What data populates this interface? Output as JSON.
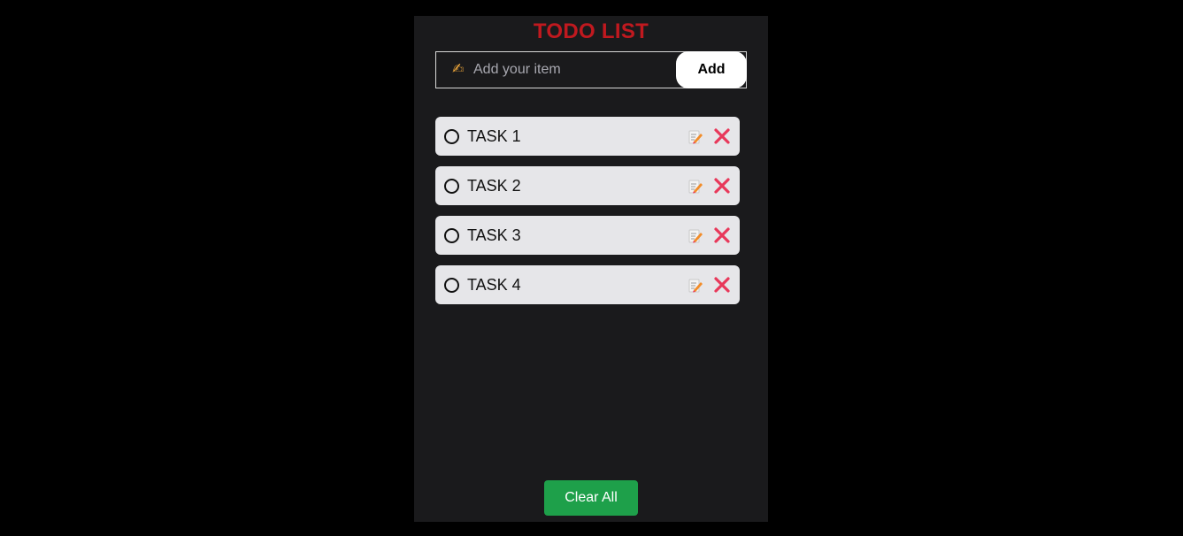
{
  "app": {
    "title": "TODO LIST"
  },
  "input": {
    "emoji": "✍",
    "placeholder": "Add your item",
    "value": "",
    "add_label": "Add"
  },
  "tasks": [
    {
      "label": "TASK 1"
    },
    {
      "label": "TASK 2"
    },
    {
      "label": "TASK 3"
    },
    {
      "label": "TASK 4"
    }
  ],
  "footer": {
    "clear_label": "Clear All"
  },
  "colors": {
    "title": "#c0191f",
    "clear_button": "#1ea04a",
    "delete_icon": "#e8385a",
    "task_background": "#e6e6e9"
  },
  "icons": {
    "task_status": "circle-outline-icon",
    "task_edit": "edit-memo-icon",
    "task_delete": "cross-icon",
    "input": "writing-hand-icon"
  }
}
